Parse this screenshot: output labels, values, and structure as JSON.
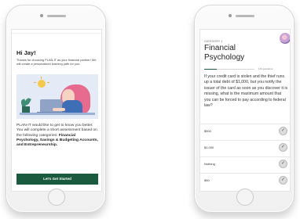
{
  "left_screen": {
    "greeting": "Hi Jay!",
    "intro": "Thanks for choosing PLAN-IT as your financial partner! We will create a personalized learning path for you.",
    "body_prefix": "PLAN-IT would like to get to know you better. You will complete a short assessment based on the following categories: ",
    "categories": "Financial Psychology, Savings & Budgeting Accounts, and Entrepreneurship.",
    "cta_label": "Let's Get Started"
  },
  "right_screen": {
    "category_label": "CATEGORY 1",
    "title": "Financial Psychology",
    "progress_text": "1/4 questions",
    "progress_fraction": 0.25,
    "question": "If your credit card is stolen and the thief runs up a total debt of $1,000, but you notify the issuer of the card as soon as you discover it is missing, what is the maximum amount that you can be forced to pay according to federal law?",
    "answers": [
      {
        "label": "$500"
      },
      {
        "label": "$1,000"
      },
      {
        "label": "Nothing"
      },
      {
        "label": "$50"
      }
    ]
  },
  "colors": {
    "accent_green": "#1a5a3f",
    "illustration_bg": "#e4ebf6",
    "hair_pink": "#e66b8f"
  }
}
